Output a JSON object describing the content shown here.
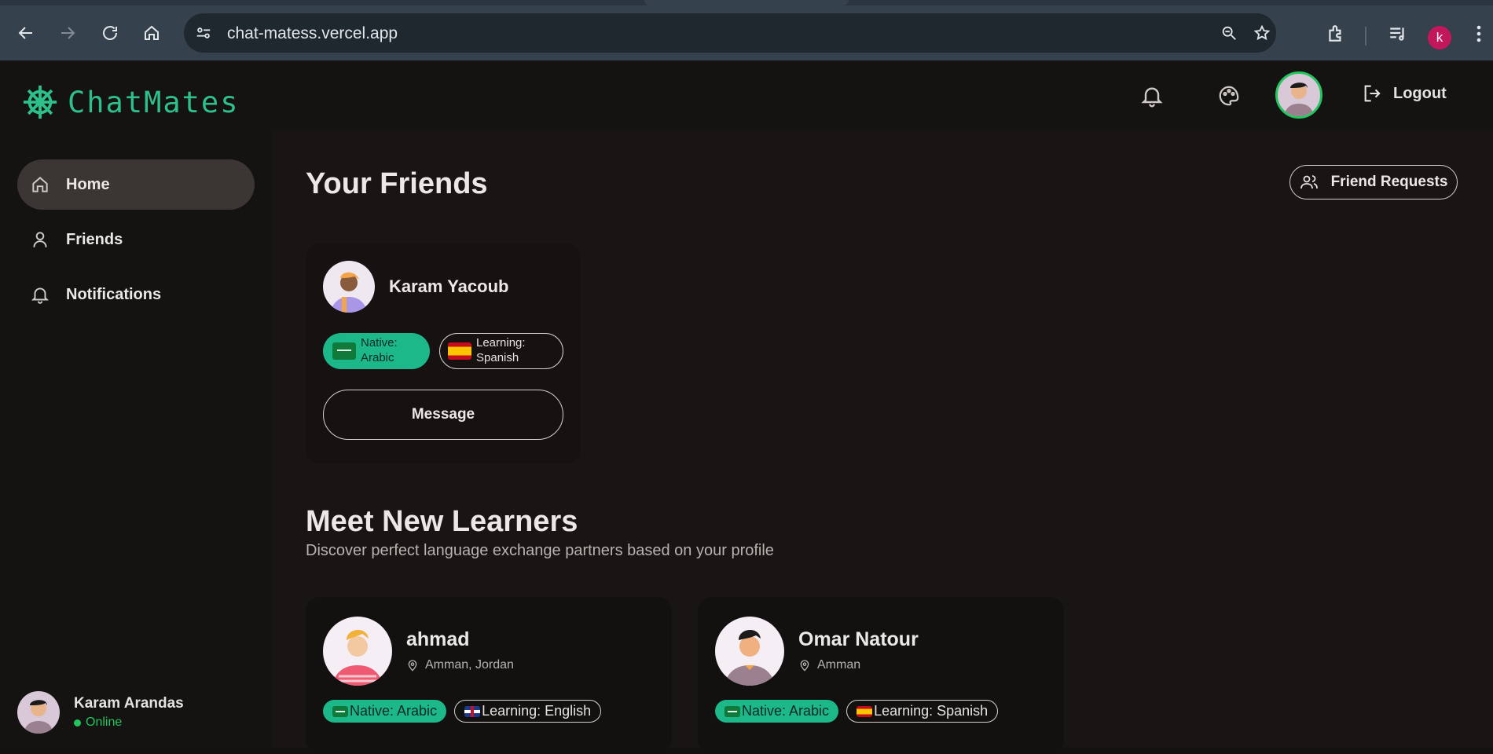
{
  "browser": {
    "url": "chat-matess.vercel.app",
    "profile_initial": "k"
  },
  "header": {
    "logo_text": "ChatMates",
    "logout_label": "Logout"
  },
  "sidebar": {
    "items": [
      {
        "label": "Home",
        "icon": "home-icon",
        "active": true
      },
      {
        "label": "Friends",
        "icon": "user-icon",
        "active": false
      },
      {
        "label": "Notifications",
        "icon": "bell-icon",
        "active": false
      }
    ],
    "user": {
      "name": "Karam Arandas",
      "status": "Online"
    }
  },
  "main": {
    "friends_title": "Your Friends",
    "friend_requests_label": "Friend Requests",
    "friend_card": {
      "name": "Karam Yacoub",
      "native_line1": "Native:",
      "native_line2": "Arabic",
      "learning_line1": "Learning:",
      "learning_line2": "Spanish",
      "message_label": "Message"
    },
    "learners_title": "Meet New Learners",
    "learners_subtitle": "Discover perfect language exchange partners based on your profile",
    "learners": [
      {
        "name": "ahmad",
        "location": "Amman, Jordan",
        "native": "Native: Arabic",
        "learning": "Learning: English",
        "learning_flag": "gb"
      },
      {
        "name": "Omar Natour",
        "location": "Amman",
        "native": "Native: Arabic",
        "learning": "Learning: Spanish",
        "learning_flag": "es"
      }
    ]
  },
  "colors": {
    "accent": "#1cb88a",
    "online": "#22c55e",
    "background": "#191515"
  }
}
